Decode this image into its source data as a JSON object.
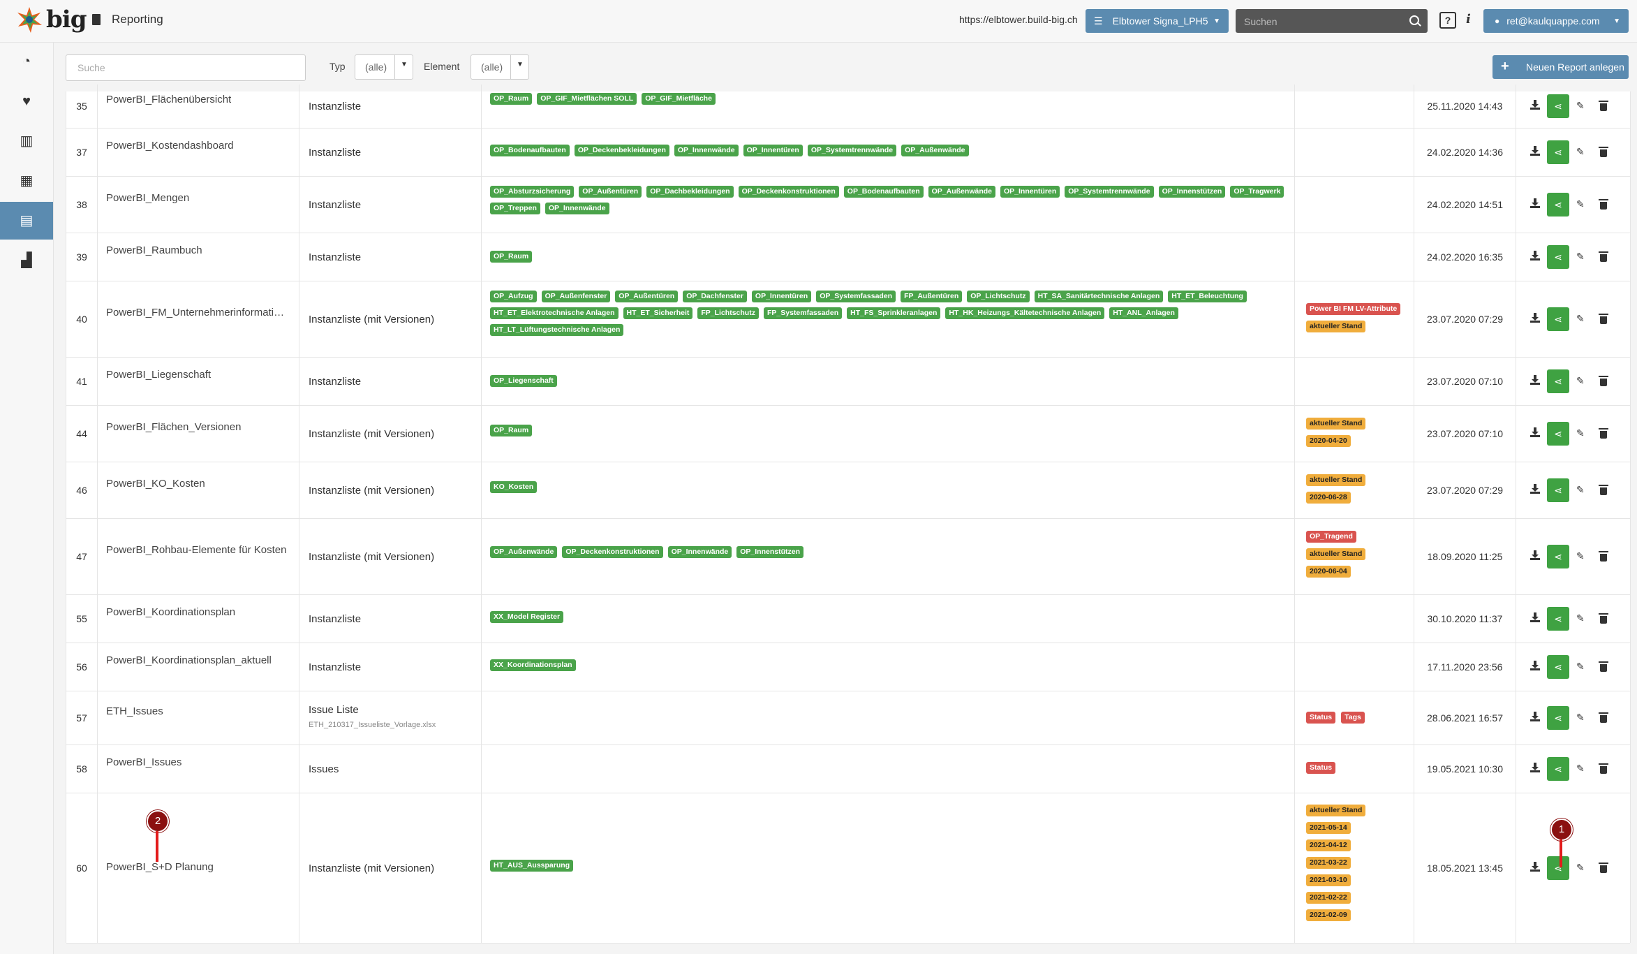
{
  "header": {
    "logo_text": "big",
    "page_title": "Reporting",
    "url": "https://elbtower.build-big.ch",
    "project": "Elbtower Signa_LPH5",
    "search_placeholder": "Suchen",
    "help": "?",
    "info": "i",
    "user": "ret@kaulquappe.com"
  },
  "sidebar": {
    "items": [
      {
        "icon": "dashboard-icon",
        "glyph": "◔"
      },
      {
        "icon": "heart-icon",
        "glyph": "♥"
      },
      {
        "icon": "bar-chart-icon",
        "glyph": "▥"
      },
      {
        "icon": "grid-icon",
        "glyph": "▦"
      },
      {
        "icon": "report-document-icon",
        "glyph": "▤"
      },
      {
        "icon": "building-chart-icon",
        "glyph": "▟"
      }
    ]
  },
  "filters": {
    "search_placeholder": "Suche",
    "type_label": "Typ",
    "type_value": "(alle)",
    "element_label": "Element",
    "element_value": "(alle)"
  },
  "new_report_label": "Neuen Report anlegen",
  "rows": [
    {
      "id": "35",
      "name": "PowerBI_Flächenübersicht",
      "type": "Instanzliste",
      "type_sub": "",
      "elements": [
        "OP_Raum",
        "OP_GIF_Mietflächen SOLL",
        "OP_GIF_Mietfläche"
      ],
      "tags": [],
      "date": "25.11.2020 14:43"
    },
    {
      "id": "37",
      "name": "PowerBI_Kostendashboard",
      "type": "Instanzliste",
      "type_sub": "",
      "elements": [
        "OP_Bodenaufbauten",
        "OP_Deckenbekleidungen",
        "OP_Innenwände",
        "OP_Innentüren",
        "OP_Systemtrennwände",
        "OP_Außenwände"
      ],
      "tags": [],
      "date": "24.02.2020 14:36"
    },
    {
      "id": "38",
      "name": "PowerBI_Mengen",
      "type": "Instanzliste",
      "type_sub": "",
      "elements": [
        "OP_Absturzsicherung",
        "OP_Außentüren",
        "OP_Dachbekleidungen",
        "OP_Deckenkonstruktionen",
        "OP_Bodenaufbauten",
        "OP_Außenwände",
        "OP_Innentüren",
        "OP_Systemtrennwände",
        "OP_Innenstützen",
        "OP_Tragwerk",
        "OP_Treppen",
        "OP_Innenwände"
      ],
      "tags": [],
      "date": "24.02.2020 14:51"
    },
    {
      "id": "39",
      "name": "PowerBI_Raumbuch",
      "type": "Instanzliste",
      "type_sub": "",
      "elements": [
        "OP_Raum"
      ],
      "tags": [],
      "date": "24.02.2020 16:35"
    },
    {
      "id": "40",
      "name": "PowerBI_FM_Unternehmerinformati…",
      "type": "Instanzliste (mit Versionen)",
      "type_sub": "",
      "elements": [
        "OP_Aufzug",
        "OP_Außenfenster",
        "OP_Außentüren",
        "OP_Dachfenster",
        "OP_Innentüren",
        "OP_Systemfassaden",
        "FP_Außentüren",
        "OP_Lichtschutz",
        "HT_SA_Sanitärtechnische Anlagen",
        "HT_ET_Beleuchtung",
        "HT_ET_Elektrotechnische Anlagen",
        "HT_ET_Sicherheit",
        "FP_Lichtschutz",
        "FP_Systemfassaden",
        "HT_FS_Sprinkleranlagen",
        "HT_HK_Heizungs_Kältetechnische Anlagen",
        "HT_ANL_Anlagen",
        "HT_LT_Lüftungstechnische Anlagen"
      ],
      "tags": [
        {
          "text": "Power BI FM LV-Attribute",
          "color": "r"
        },
        {
          "text": "aktueller Stand",
          "color": "o"
        }
      ],
      "date": "23.07.2020 07:29"
    },
    {
      "id": "41",
      "name": "PowerBI_Liegenschaft",
      "type": "Instanzliste",
      "type_sub": "",
      "elements": [
        "OP_Liegenschaft"
      ],
      "tags": [],
      "date": "23.07.2020 07:10"
    },
    {
      "id": "44",
      "name": "PowerBI_Flächen_Versionen",
      "type": "Instanzliste (mit Versionen)",
      "type_sub": "",
      "elements": [
        "OP_Raum"
      ],
      "tags": [
        {
          "text": "aktueller Stand",
          "color": "o"
        },
        {
          "text": "2020-04-20",
          "color": "o"
        }
      ],
      "date": "23.07.2020 07:10"
    },
    {
      "id": "46",
      "name": "PowerBI_KO_Kosten",
      "type": "Instanzliste (mit Versionen)",
      "type_sub": "",
      "elements": [
        "KO_Kosten"
      ],
      "tags": [
        {
          "text": "aktueller Stand",
          "color": "o"
        },
        {
          "text": "2020-06-28",
          "color": "o"
        }
      ],
      "date": "23.07.2020 07:29"
    },
    {
      "id": "47",
      "name": "PowerBI_Rohbau-Elemente für Kosten",
      "type": "Instanzliste (mit Versionen)",
      "type_sub": "",
      "elements": [
        "OP_Außenwände",
        "OP_Deckenkonstruktionen",
        "OP_Innenwände",
        "OP_Innenstützen"
      ],
      "tags": [
        {
          "text": "OP_Tragend",
          "color": "r"
        },
        {
          "text": "aktueller Stand",
          "color": "o"
        },
        {
          "text": "2020-06-04",
          "color": "o"
        }
      ],
      "date": "18.09.2020 11:25"
    },
    {
      "id": "55",
      "name": "PowerBI_Koordinationsplan",
      "type": "Instanzliste",
      "type_sub": "",
      "elements": [
        "XX_Model Register"
      ],
      "tags": [],
      "date": "30.10.2020 11:37"
    },
    {
      "id": "56",
      "name": "PowerBI_Koordinationsplan_aktuell",
      "type": "Instanzliste",
      "type_sub": "",
      "elements": [
        "XX_Koordinationsplan"
      ],
      "tags": [],
      "date": "17.11.2020 23:56"
    },
    {
      "id": "57",
      "name": "ETH_Issues",
      "type": "Issue Liste",
      "type_sub": "ETH_210317_Issueliste_Vorlage.xlsx",
      "elements": [],
      "tags": [
        {
          "text": "Status",
          "color": "r"
        },
        {
          "text": "Tags",
          "color": "r"
        }
      ],
      "date": "28.06.2021 16:57"
    },
    {
      "id": "58",
      "name": "PowerBI_Issues",
      "type": "Issues",
      "type_sub": "",
      "elements": [],
      "tags": [
        {
          "text": "Status",
          "color": "r"
        }
      ],
      "date": "19.05.2021 10:30"
    },
    {
      "id": "60",
      "name": "PowerBI_S+D Planung",
      "type": "Instanzliste (mit Versionen)",
      "type_sub": "",
      "elements": [
        "HT_AUS_Aussparung"
      ],
      "tags": [
        {
          "text": "aktueller Stand",
          "color": "o"
        },
        {
          "text": "2021-05-14",
          "color": "o"
        },
        {
          "text": "2021-04-12",
          "color": "o"
        },
        {
          "text": "2021-03-22",
          "color": "o"
        },
        {
          "text": "2021-03-10",
          "color": "o"
        },
        {
          "text": "2021-02-22",
          "color": "o"
        },
        {
          "text": "2021-02-09",
          "color": "o"
        }
      ],
      "date": "18.05.2021 13:45"
    }
  ],
  "annotations": [
    {
      "label": "1"
    },
    {
      "label": "2"
    }
  ]
}
